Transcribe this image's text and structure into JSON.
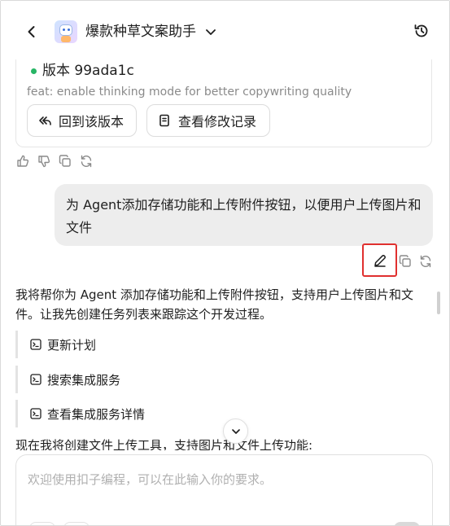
{
  "header": {
    "title": "爆款种草文案助手",
    "icons": [
      "back-arrow-icon",
      "robot-avatar",
      "chevron-down-icon",
      "history-icon"
    ]
  },
  "version_card": {
    "title": "版本 99ada1c",
    "description": "feat: enable thinking mode for better copywriting quality",
    "revert_label": "回到该版本",
    "changes_label": "查看修改记录",
    "status_color": "#27b565"
  },
  "messages": {
    "user_text": "为 Agent添加存储功能和上传附件按钮，以便用户上传图片和文件",
    "ai_text": "我将帮你为 Agent 添加存储功能和上传附件按钮，支持用户上传图片和文件。让我先创建任务列表来跟踪这个开发过程。",
    "tasks": [
      "更新计划",
      "搜索集成服务",
      "查看集成服务详情"
    ],
    "ai_text_2": "现在我将创建文件上传工具，支持图片和文件上传功能:"
  },
  "composer": {
    "placeholder": "欢迎使用扣子编程，可以在此输入你的要求。"
  },
  "colors": {
    "highlight": "#e0302f",
    "user_bubble": "#ededed"
  }
}
